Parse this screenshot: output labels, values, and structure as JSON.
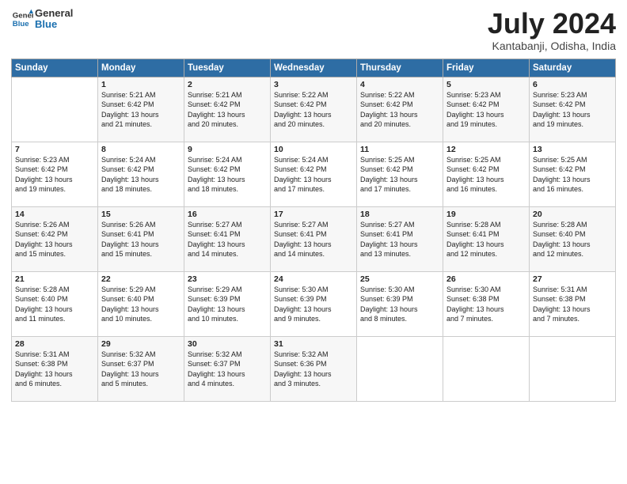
{
  "header": {
    "logo_general": "General",
    "logo_blue": "Blue",
    "month_title": "July 2024",
    "location": "Kantabanji, Odisha, India"
  },
  "days_of_week": [
    "Sunday",
    "Monday",
    "Tuesday",
    "Wednesday",
    "Thursday",
    "Friday",
    "Saturday"
  ],
  "weeks": [
    [
      {
        "day": "",
        "info": ""
      },
      {
        "day": "1",
        "info": "Sunrise: 5:21 AM\nSunset: 6:42 PM\nDaylight: 13 hours\nand 21 minutes."
      },
      {
        "day": "2",
        "info": "Sunrise: 5:21 AM\nSunset: 6:42 PM\nDaylight: 13 hours\nand 20 minutes."
      },
      {
        "day": "3",
        "info": "Sunrise: 5:22 AM\nSunset: 6:42 PM\nDaylight: 13 hours\nand 20 minutes."
      },
      {
        "day": "4",
        "info": "Sunrise: 5:22 AM\nSunset: 6:42 PM\nDaylight: 13 hours\nand 20 minutes."
      },
      {
        "day": "5",
        "info": "Sunrise: 5:23 AM\nSunset: 6:42 PM\nDaylight: 13 hours\nand 19 minutes."
      },
      {
        "day": "6",
        "info": "Sunrise: 5:23 AM\nSunset: 6:42 PM\nDaylight: 13 hours\nand 19 minutes."
      }
    ],
    [
      {
        "day": "7",
        "info": "Sunrise: 5:23 AM\nSunset: 6:42 PM\nDaylight: 13 hours\nand 19 minutes."
      },
      {
        "day": "8",
        "info": "Sunrise: 5:24 AM\nSunset: 6:42 PM\nDaylight: 13 hours\nand 18 minutes."
      },
      {
        "day": "9",
        "info": "Sunrise: 5:24 AM\nSunset: 6:42 PM\nDaylight: 13 hours\nand 18 minutes."
      },
      {
        "day": "10",
        "info": "Sunrise: 5:24 AM\nSunset: 6:42 PM\nDaylight: 13 hours\nand 17 minutes."
      },
      {
        "day": "11",
        "info": "Sunrise: 5:25 AM\nSunset: 6:42 PM\nDaylight: 13 hours\nand 17 minutes."
      },
      {
        "day": "12",
        "info": "Sunrise: 5:25 AM\nSunset: 6:42 PM\nDaylight: 13 hours\nand 16 minutes."
      },
      {
        "day": "13",
        "info": "Sunrise: 5:25 AM\nSunset: 6:42 PM\nDaylight: 13 hours\nand 16 minutes."
      }
    ],
    [
      {
        "day": "14",
        "info": "Sunrise: 5:26 AM\nSunset: 6:42 PM\nDaylight: 13 hours\nand 15 minutes."
      },
      {
        "day": "15",
        "info": "Sunrise: 5:26 AM\nSunset: 6:41 PM\nDaylight: 13 hours\nand 15 minutes."
      },
      {
        "day": "16",
        "info": "Sunrise: 5:27 AM\nSunset: 6:41 PM\nDaylight: 13 hours\nand 14 minutes."
      },
      {
        "day": "17",
        "info": "Sunrise: 5:27 AM\nSunset: 6:41 PM\nDaylight: 13 hours\nand 14 minutes."
      },
      {
        "day": "18",
        "info": "Sunrise: 5:27 AM\nSunset: 6:41 PM\nDaylight: 13 hours\nand 13 minutes."
      },
      {
        "day": "19",
        "info": "Sunrise: 5:28 AM\nSunset: 6:41 PM\nDaylight: 13 hours\nand 12 minutes."
      },
      {
        "day": "20",
        "info": "Sunrise: 5:28 AM\nSunset: 6:40 PM\nDaylight: 13 hours\nand 12 minutes."
      }
    ],
    [
      {
        "day": "21",
        "info": "Sunrise: 5:28 AM\nSunset: 6:40 PM\nDaylight: 13 hours\nand 11 minutes."
      },
      {
        "day": "22",
        "info": "Sunrise: 5:29 AM\nSunset: 6:40 PM\nDaylight: 13 hours\nand 10 minutes."
      },
      {
        "day": "23",
        "info": "Sunrise: 5:29 AM\nSunset: 6:39 PM\nDaylight: 13 hours\nand 10 minutes."
      },
      {
        "day": "24",
        "info": "Sunrise: 5:30 AM\nSunset: 6:39 PM\nDaylight: 13 hours\nand 9 minutes."
      },
      {
        "day": "25",
        "info": "Sunrise: 5:30 AM\nSunset: 6:39 PM\nDaylight: 13 hours\nand 8 minutes."
      },
      {
        "day": "26",
        "info": "Sunrise: 5:30 AM\nSunset: 6:38 PM\nDaylight: 13 hours\nand 7 minutes."
      },
      {
        "day": "27",
        "info": "Sunrise: 5:31 AM\nSunset: 6:38 PM\nDaylight: 13 hours\nand 7 minutes."
      }
    ],
    [
      {
        "day": "28",
        "info": "Sunrise: 5:31 AM\nSunset: 6:38 PM\nDaylight: 13 hours\nand 6 minutes."
      },
      {
        "day": "29",
        "info": "Sunrise: 5:32 AM\nSunset: 6:37 PM\nDaylight: 13 hours\nand 5 minutes."
      },
      {
        "day": "30",
        "info": "Sunrise: 5:32 AM\nSunset: 6:37 PM\nDaylight: 13 hours\nand 4 minutes."
      },
      {
        "day": "31",
        "info": "Sunrise: 5:32 AM\nSunset: 6:36 PM\nDaylight: 13 hours\nand 3 minutes."
      },
      {
        "day": "",
        "info": ""
      },
      {
        "day": "",
        "info": ""
      },
      {
        "day": "",
        "info": ""
      }
    ]
  ]
}
